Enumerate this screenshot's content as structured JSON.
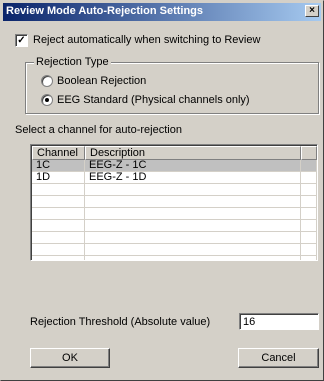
{
  "window": {
    "title": "Review Mode Auto-Rejection Settings",
    "close_glyph": "×"
  },
  "reject_auto": {
    "label": "Reject automatically when switching to Review",
    "checked": true,
    "check_glyph": "✓"
  },
  "rejection_type": {
    "legend": "Rejection Type",
    "options": [
      {
        "label": "Boolean Rejection",
        "selected": false
      },
      {
        "label": "EEG Standard (Physical channels only)",
        "selected": true
      }
    ]
  },
  "channel_select": {
    "label": "Select a channel for auto-rejection"
  },
  "channel_list": {
    "columns": [
      "Channel",
      "Description"
    ],
    "rows": [
      {
        "channel": "1C",
        "description": "EEG-Z - 1C",
        "selected": true
      },
      {
        "channel": "1D",
        "description": "EEG-Z - 1D",
        "selected": false
      }
    ]
  },
  "threshold": {
    "label": "Rejection Threshold (Absolute value)",
    "value": "16"
  },
  "buttons": {
    "ok": "OK",
    "cancel": "Cancel"
  }
}
